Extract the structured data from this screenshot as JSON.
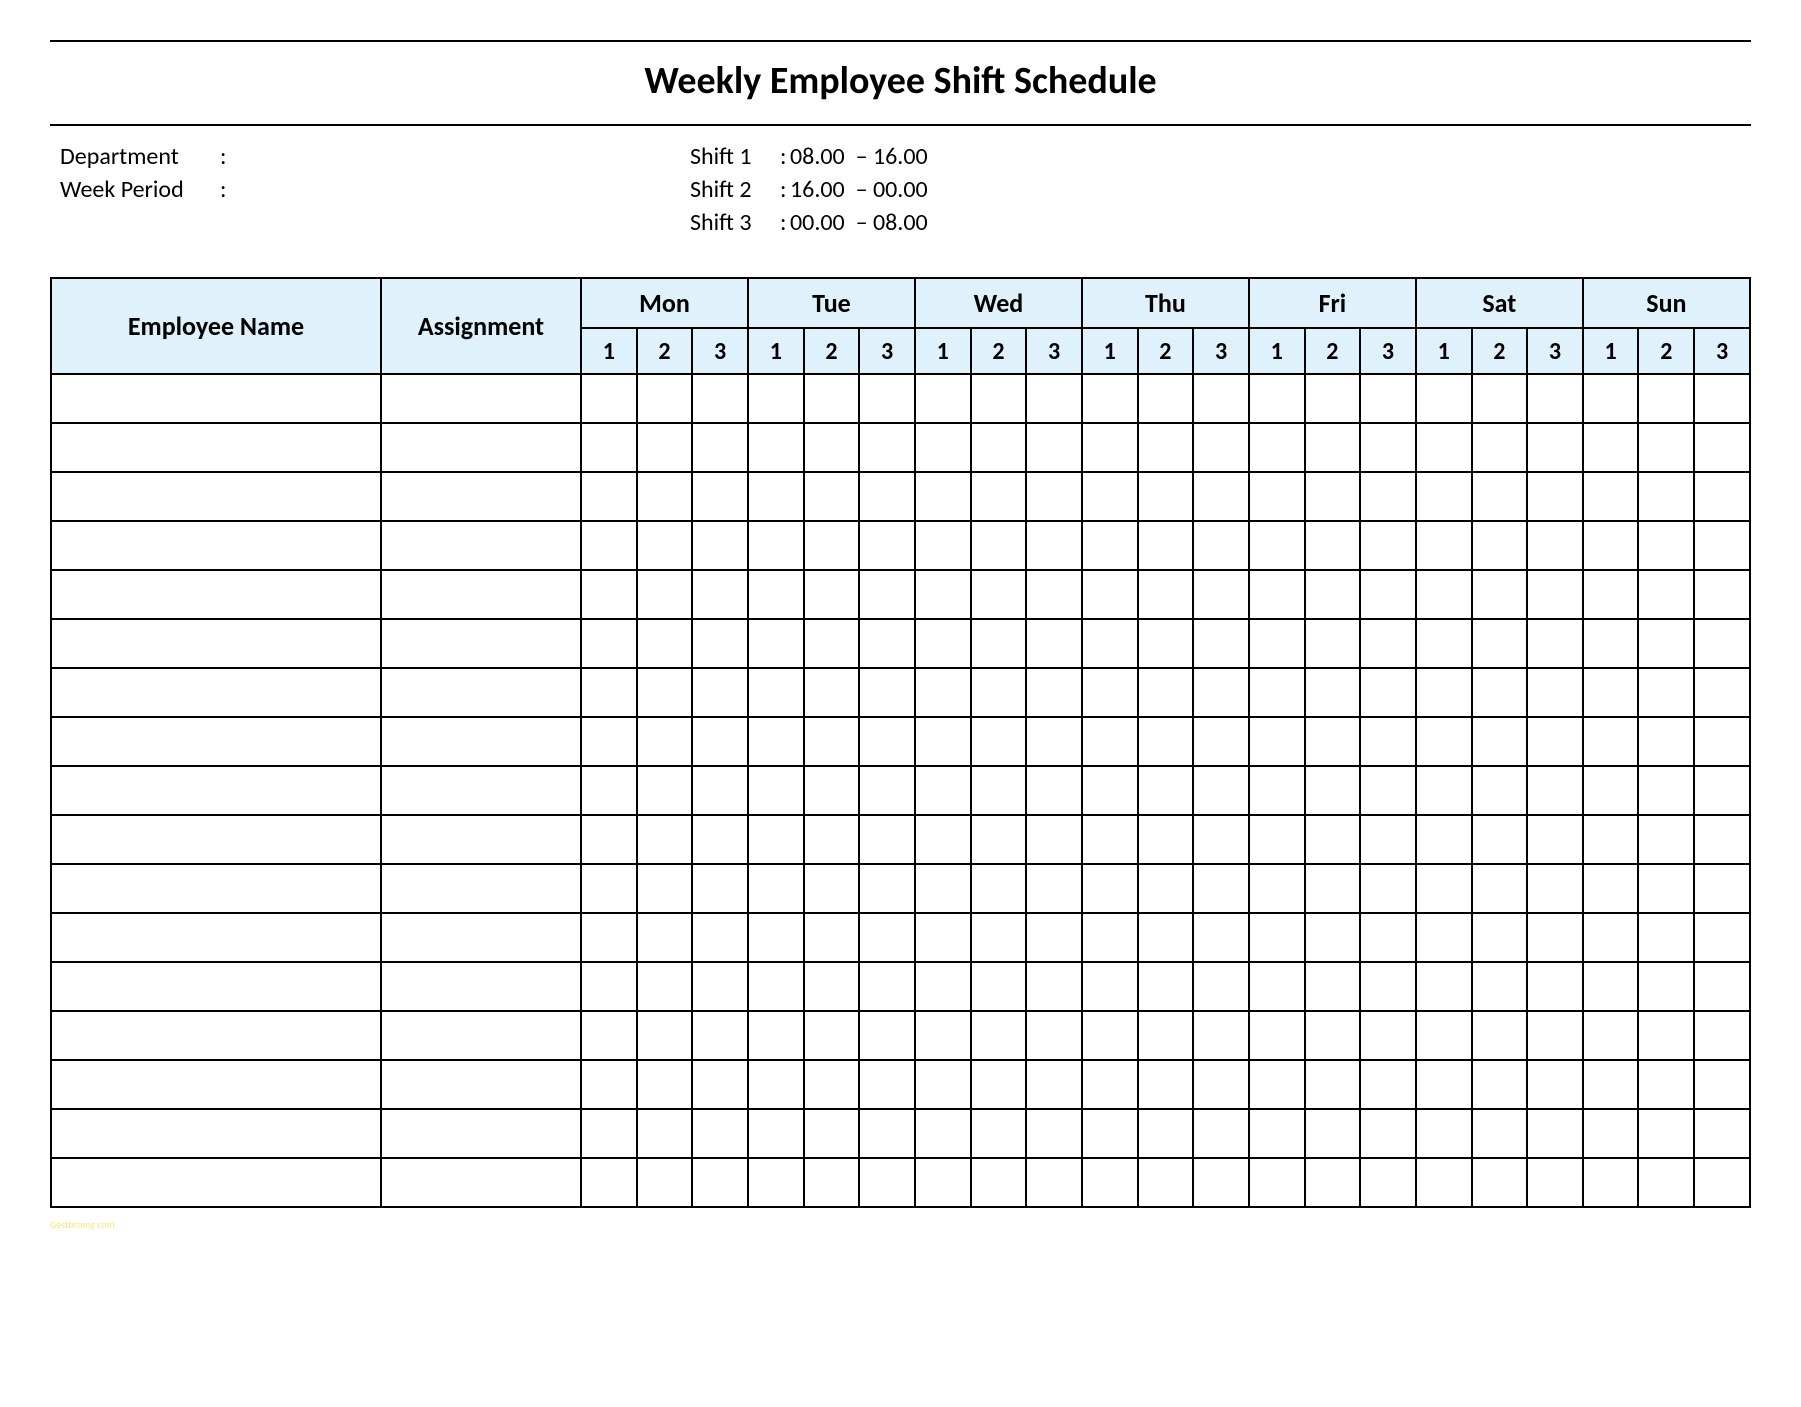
{
  "title": "Weekly Employee Shift Schedule",
  "meta": {
    "department_label": "Department",
    "department_value": "",
    "week_period_label": "Week  Period",
    "week_period_value": "",
    "shifts": [
      {
        "label": "Shift 1",
        "time": "08.00  – 16.00"
      },
      {
        "label": "Shift 2",
        "time": "16.00  – 00.00"
      },
      {
        "label": "Shift 3",
        "time": "00.00  – 08.00"
      }
    ]
  },
  "headers": {
    "employee_name": "Employee Name",
    "assignment": "Assignment",
    "days": [
      "Mon",
      "Tue",
      "Wed",
      "Thu",
      "Fri",
      "Sat",
      "Sun"
    ],
    "shift_nums": [
      "1",
      "2",
      "3"
    ]
  },
  "row_count": 17,
  "footer": "Gestbromg com"
}
